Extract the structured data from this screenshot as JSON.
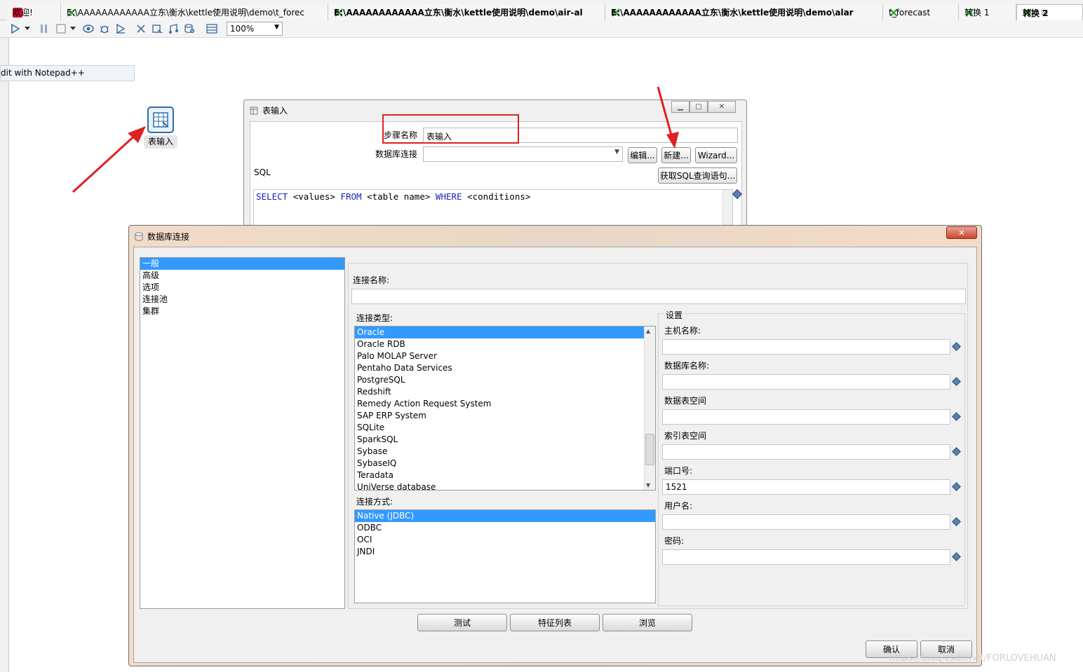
{
  "tabs": [
    {
      "label": "欢迎!",
      "bold": false
    },
    {
      "label": "E:\\AAAAAAAAAAAA立东\\衡水\\kettle使用说明\\demo\\t_forec",
      "bold": false
    },
    {
      "label": "E:\\AAAAAAAAAAAA立东\\衡水\\kettle使用说明\\demo\\air-al",
      "bold": true
    },
    {
      "label": "E:\\AAAAAAAAAAAA立东\\衡水\\kettle使用说明\\demo\\alar",
      "bold": true
    },
    {
      "label": "t_forecast",
      "bold": false
    },
    {
      "label": "转换 1",
      "bold": false
    },
    {
      "label": "转换 2",
      "bold": true,
      "close": "☒"
    }
  ],
  "toolbar": {
    "zoom": "100%"
  },
  "canvas": {
    "notepad_hint": "dit with Notepad++",
    "step_label": "表输入"
  },
  "table_input_dialog": {
    "title": "表输入",
    "step_name_label": "步骤名称",
    "step_name_value": "表输入",
    "db_conn_label": "数据库连接",
    "edit_button": "编辑...",
    "new_button": "新建...",
    "wizard_button": "Wizard...",
    "sql_label": "SQL",
    "get_sql_button": "获取SQL查询语句...",
    "sql_text": {
      "select": "SELECT",
      "values": "<values>",
      "from": "FROM",
      "table": "<table name>",
      "where": "WHERE",
      "conditions": "<conditions>"
    }
  },
  "db_dialog": {
    "title": "数据库连接",
    "close": "✕",
    "nav": [
      "一般",
      "高级",
      "选项",
      "连接池",
      "集群"
    ],
    "conn_name_label": "连接名称:",
    "conn_type_label": "连接类型:",
    "conn_types": [
      "Oracle",
      "Oracle RDB",
      "Palo MOLAP Server",
      "Pentaho Data Services",
      "PostgreSQL",
      "Redshift",
      "Remedy Action Request System",
      "SAP ERP System",
      "SQLite",
      "SparkSQL",
      "Sybase",
      "SybaseIQ",
      "Teradata",
      "UniVerse database"
    ],
    "access_label": "连接方式:",
    "access_types": [
      "Native (JDBC)",
      "ODBC",
      "OCI",
      "JNDI"
    ],
    "settings_label": "设置",
    "settings": [
      {
        "label": "主机名称:",
        "value": ""
      },
      {
        "label": "数据库名称:",
        "value": ""
      },
      {
        "label": "数据表空间",
        "value": ""
      },
      {
        "label": "索引表空间",
        "value": ""
      },
      {
        "label": "端口号:",
        "value": "1521"
      },
      {
        "label": "用户名:",
        "value": ""
      },
      {
        "label": "密码:",
        "value": ""
      }
    ],
    "test_button": "测试",
    "features_button": "特征列表",
    "explore_button": "浏览",
    "ok_button": "确认",
    "cancel_button": "取消"
  },
  "watermark": "https://blog.csdn.net/FORLOVEHUAN",
  "colors": {
    "selection": "#3399ff",
    "arrow": "#e02020",
    "keyword": "#1a24b8"
  }
}
